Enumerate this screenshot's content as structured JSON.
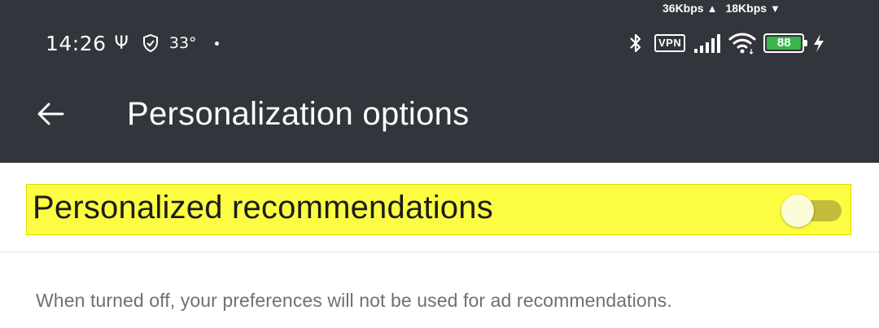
{
  "status_bar": {
    "upload_speed": "36Kbps",
    "download_speed": "18Kbps",
    "time": "14:26",
    "usb_icon": "usb-icon",
    "shield_icon": "shield-icon",
    "temperature": "33°",
    "bluetooth_icon": "bluetooth-icon",
    "vpn_label": "VPN",
    "signal_icon": "signal-icon",
    "wifi_icon": "wifi-icon",
    "battery_level": "88",
    "charging_icon": "charging-icon"
  },
  "header": {
    "back_icon": "arrow-back-icon",
    "title": "Personalization options",
    "background_color": "#32353b"
  },
  "setting": {
    "label": "Personalized recommendations",
    "toggle_state": "off",
    "highlight_color": "#fcfc42"
  },
  "description": "When turned off, your preferences will not be used for ad recommendations."
}
